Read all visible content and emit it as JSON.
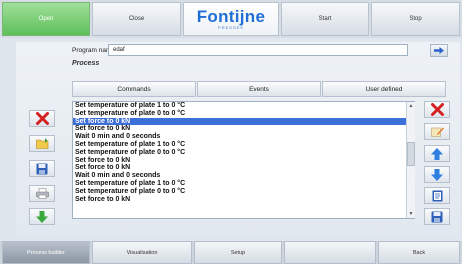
{
  "topbar": {
    "open_label": "Open",
    "close_label": "Close",
    "start_label": "Start",
    "stop_label": "Stop",
    "logo_text": "Fontijne",
    "logo_sub": "PRESSES"
  },
  "program": {
    "label": "Program name",
    "value": "edaf"
  },
  "process": {
    "label": "Process",
    "tabs": [
      "Commands",
      "Events",
      "User defined"
    ],
    "items": [
      "Set temperature of plate 1 to 0 °C",
      "Set temperature of plate 0 to 0 °C",
      "Set force to 0 kN",
      "Set force to 0 kN",
      "Wait 0 min and 0 seconds",
      "Set temperature of plate 1 to 0 °C",
      "Set temperature of plate 0 to 0 °C",
      "Set force to 0 kN",
      "Set force to 0 kN",
      "Wait 0 min and 0 seconds",
      "Set temperature of plate 1 to 0 °C",
      "Set temperature of plate 0 to 0 °C",
      "Set force to 0 kN"
    ],
    "selected_index": 2
  },
  "bottombar": {
    "items": [
      "Process builder",
      "Visualisation",
      "Setup",
      "",
      "Back"
    ]
  },
  "colors": {
    "open_green": "#5fbf5a",
    "selection_blue": "#3d6fd8",
    "logo_blue": "#1f6fd6"
  }
}
